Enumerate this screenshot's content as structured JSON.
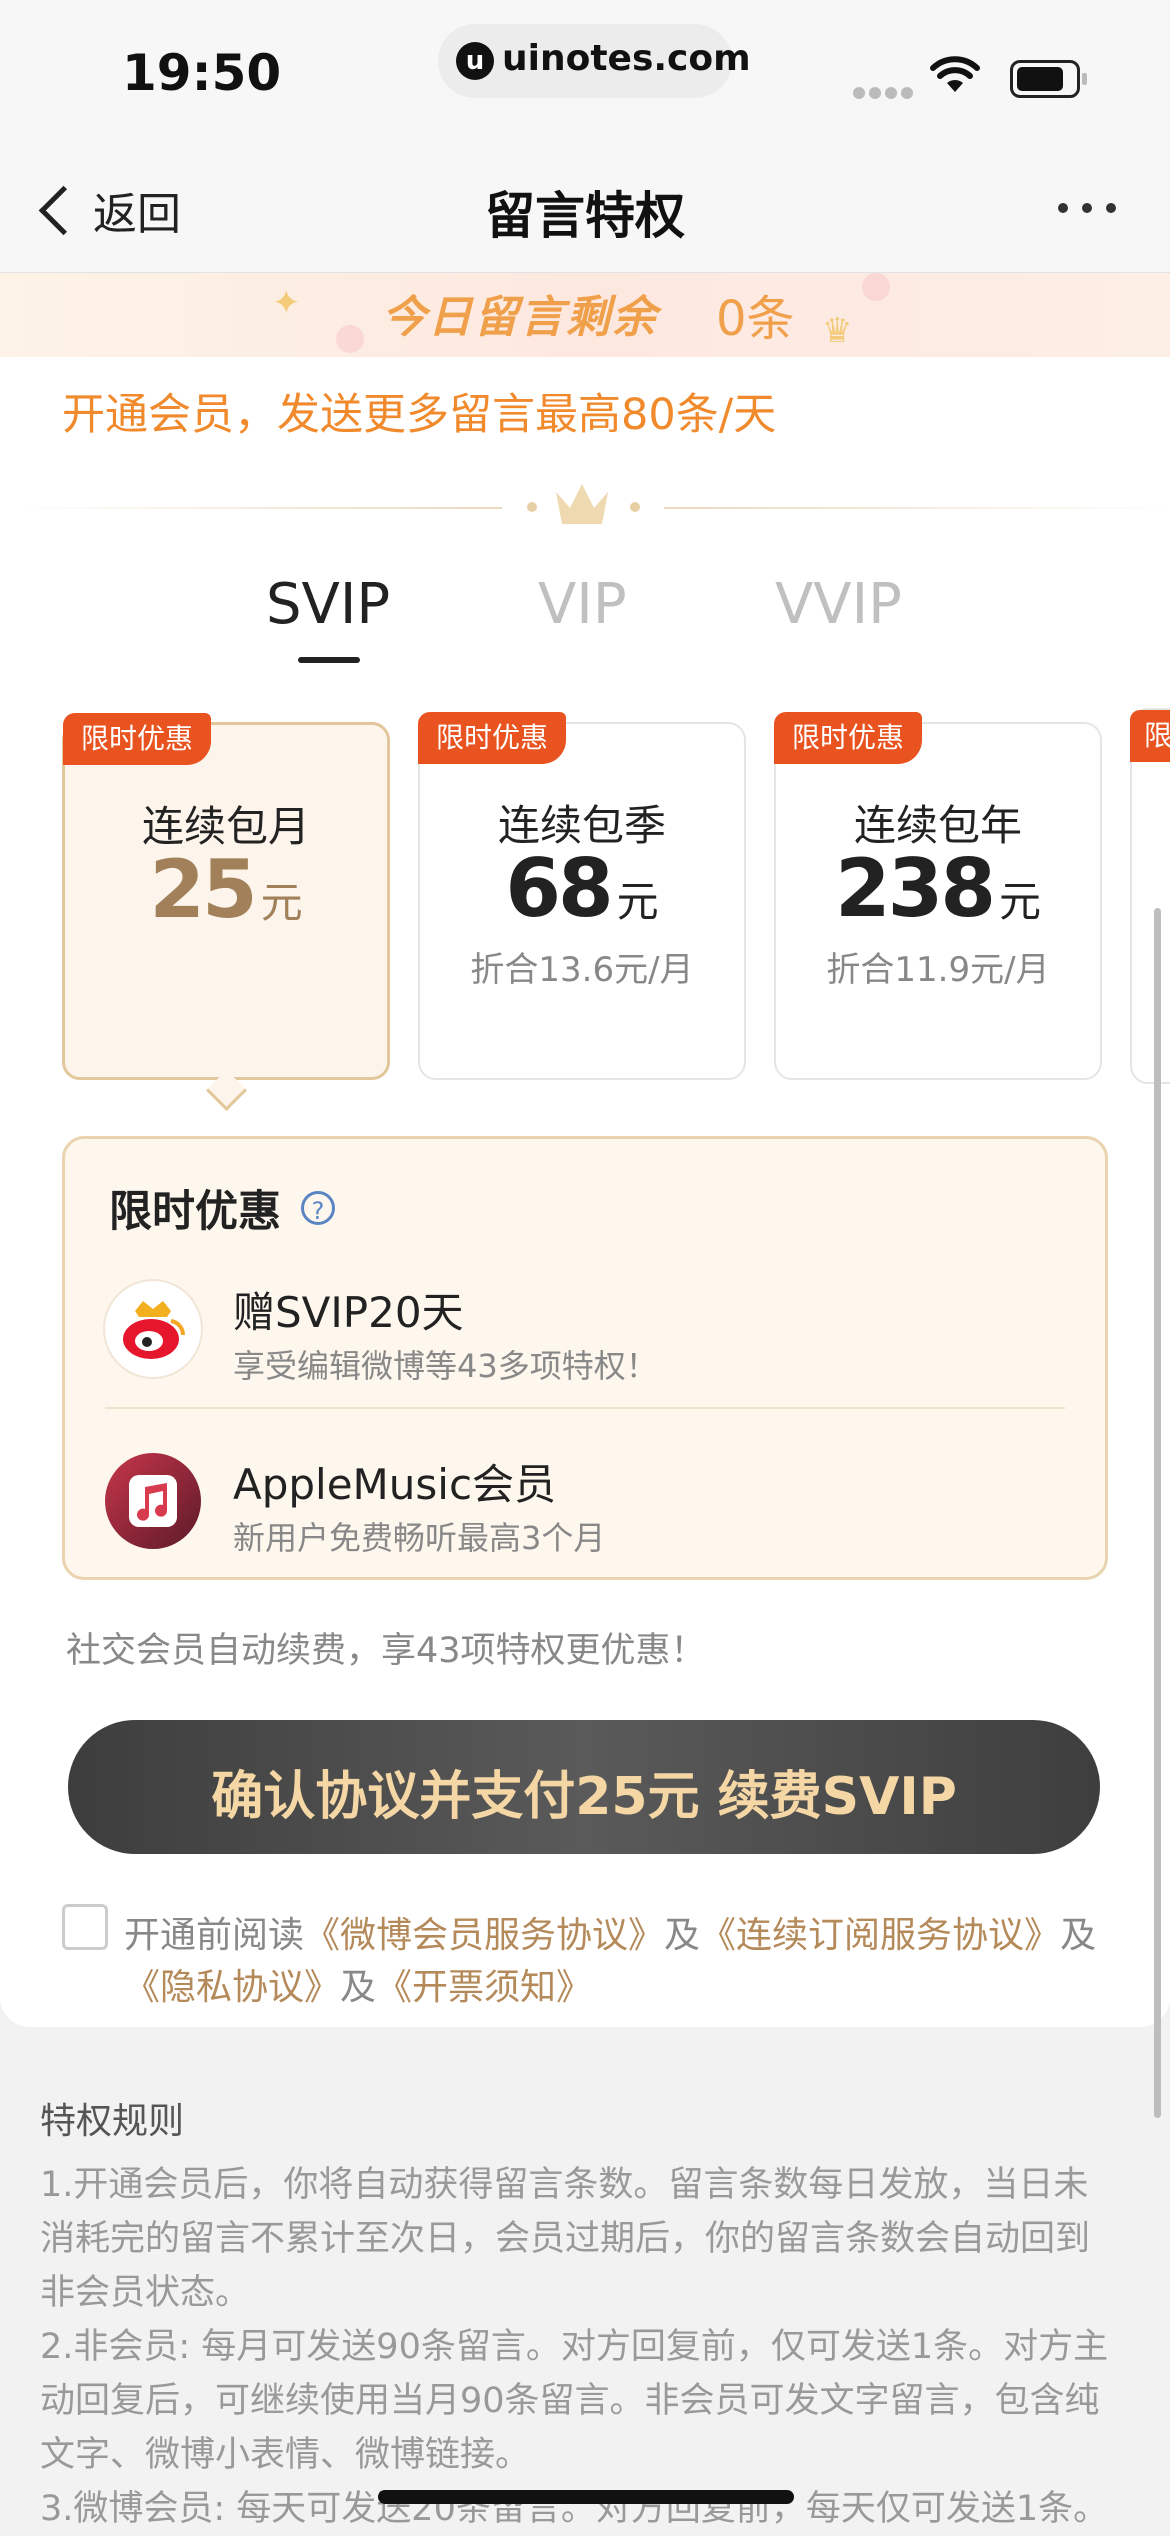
{
  "status": {
    "time": "19:50",
    "url": "uinotes.com"
  },
  "nav": {
    "back_label": "返回",
    "title": "留言特权"
  },
  "banner": {
    "label": "今日留言剩余",
    "count": "0条"
  },
  "promo": {
    "text": "开通会员，发送更多留言最高80条/天"
  },
  "tabs": [
    {
      "label": "SVIP",
      "active": true
    },
    {
      "label": "VIP",
      "active": false
    },
    {
      "label": "VVIP",
      "active": false
    }
  ],
  "plans": [
    {
      "badge": "限时优惠",
      "name": "连续包月",
      "price": "25",
      "unit": "元",
      "per_month": "",
      "selected": true
    },
    {
      "badge": "限时优惠",
      "name": "连续包季",
      "price": "68",
      "unit": "元",
      "per_month": "折合13.6元/月",
      "selected": false
    },
    {
      "badge": "限时优惠",
      "name": "连续包年",
      "price": "238",
      "unit": "元",
      "per_month": "折合11.9元/月",
      "selected": false
    },
    {
      "badge": "限",
      "name": "",
      "price": "",
      "unit": "",
      "per_month": "",
      "selected": false
    }
  ],
  "offer": {
    "title": "限时优惠",
    "help_icon": "?",
    "items": [
      {
        "icon": "weibo-svip-icon",
        "title": "赠SVIP20天",
        "subtitle": "享受编辑微博等43多项特权！"
      },
      {
        "icon": "apple-music-icon",
        "title": "AppleMusic会员",
        "subtitle": "新用户免费畅听最高3个月"
      }
    ]
  },
  "renew_note": "社交会员自动续费，享43项特权更优惠！",
  "pay_button": "确认协议并支付25元 续费SVIP",
  "agreement": {
    "prefix": "开通前阅读",
    "link1": "《微博会员服务协议》",
    "and1": "及",
    "link2": "《连续订阅服务协议》",
    "and2": "及",
    "link3": "《隐私协议》",
    "and3": "及",
    "link4": "《开票须知》"
  },
  "rules": {
    "title": "特权规则",
    "lines": [
      "1.开通会员后，你将自动获得留言条数。留言条数每日发放，当日未",
      "消耗完的留言不累计至次日，会员过期后，你的留言条数会自动回到",
      "非会员状态。",
      "2.非会员: 每月可发送90条留言。对方回复前，仅可发送1条。对方主",
      "动回复后，可继续使用当月90条留言。非会员可发文字留言，包含纯",
      "文字、微博小表情、微博链接。",
      "3.微博会员: 每天可发送20条留言。对方回复前，每天仅可发送1条。"
    ]
  },
  "colors": {
    "accent_orange": "#f08a2c",
    "badge_red": "#e8531f",
    "gold": "#a1805a",
    "pay_text": "#f4d7a5"
  }
}
